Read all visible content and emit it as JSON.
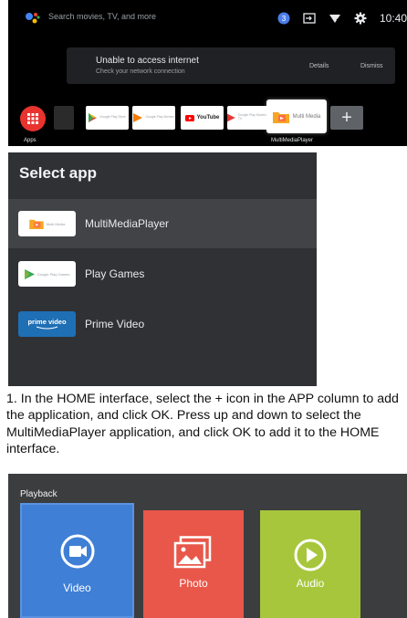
{
  "tv_home": {
    "search_text": "Search movies, TV, and more",
    "notification_badge": "3",
    "clock": "10:40",
    "notice": {
      "title": "Unable to access internet",
      "subtitle": "Check your network connection",
      "details": "Details",
      "dismiss": "Dismiss"
    },
    "apps_label": "Apps",
    "tiles": {
      "google_play_store": "Google Play Store",
      "google_play_movies": "Google Play Movies",
      "youtube": "YouTube",
      "google_play_movies_tv": "Google Play Movies & TV",
      "multimedia": "Multi Media"
    },
    "selected_app_label": "MultiMediaPlayer",
    "add_symbol": "+"
  },
  "select_app": {
    "title": "Select app",
    "items": [
      {
        "thumb_text": "Multi Media",
        "name": "MultiMediaPlayer"
      },
      {
        "thumb_text": "Google Play Games",
        "name": "Play Games"
      },
      {
        "thumb_text": "prime video",
        "name": "Prime Video"
      }
    ]
  },
  "instruction": "1. In the HOME interface, select the + icon in the APP column to add the application, and click OK. Press up and down to select the MultiMediaPlayer application, and click OK to add it to the HOME interface.",
  "playback": {
    "title": "Playback",
    "cards": [
      {
        "label": "Video",
        "color": "#3f7fd6",
        "icon": "video-camera-icon"
      },
      {
        "label": "Photo",
        "color": "#e8574a",
        "icon": "photo-icon"
      },
      {
        "label": "Audio",
        "color": "#a7c63c",
        "icon": "play-icon"
      }
    ]
  },
  "colors": {
    "apps_button": "#e8332f",
    "youtube_red": "#ff0000",
    "prime_blue": "#1f6fb5"
  }
}
